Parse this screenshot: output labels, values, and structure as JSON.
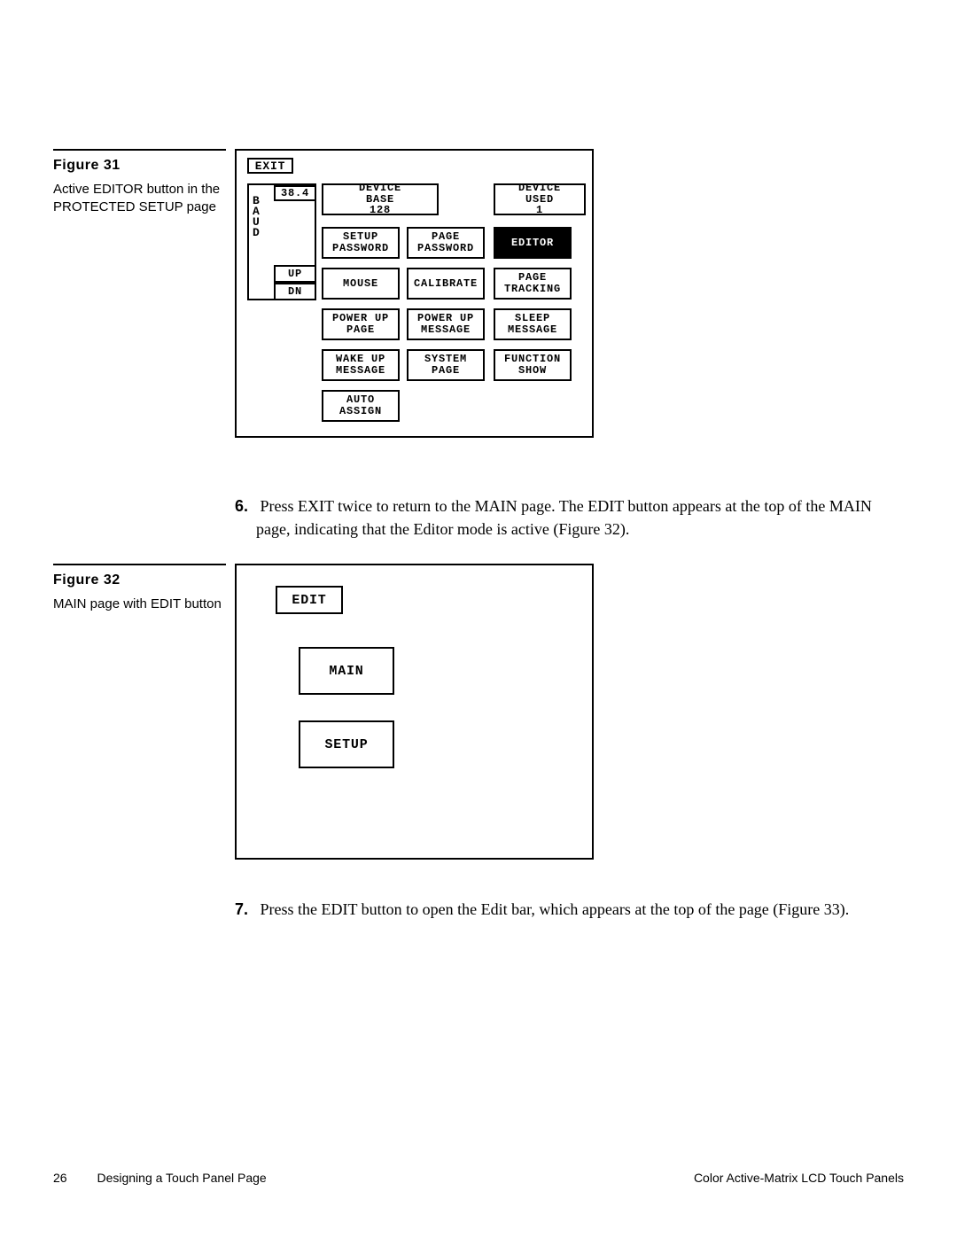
{
  "fig31": {
    "label": "Figure 31",
    "caption": "Active EDITOR button in the PROTECTED SETUP page",
    "exit": "EXIT",
    "baud": [
      "B",
      "A",
      "U",
      "D"
    ],
    "baud_value": "38.4",
    "up": "UP",
    "dn": "DN",
    "device_base_label": "DEVICE BASE",
    "device_base_val": "128",
    "device_used_label": "DEVICE USED",
    "device_used_val": "1",
    "setup_password": "SETUP PASSWORD",
    "page_password": "PAGE PASSWORD",
    "editor": "EDITOR",
    "mouse": "MOUSE",
    "calibrate": "CALIBRATE",
    "page_tracking": "PAGE TRACKING",
    "power_up_page": "POWER UP PAGE",
    "power_up_message": "POWER UP MESSAGE",
    "sleep_message": "SLEEP MESSAGE",
    "wake_up_message": "WAKE UP MESSAGE",
    "system_page": "SYSTEM PAGE",
    "function_show": "FUNCTION SHOW",
    "auto_assign": "AUTO ASSIGN"
  },
  "fig32": {
    "label": "Figure 32",
    "caption": "MAIN page with EDIT button",
    "edit": "EDIT",
    "main": "MAIN",
    "setup": "SETUP"
  },
  "steps": {
    "six_num": "6.",
    "six_text": "Press EXIT twice to return to the MAIN page. The EDIT button appears at the top of the MAIN page, indicating that the Editor mode is active (Figure 32).",
    "seven_num": "7.",
    "seven_text": "Press the EDIT button to open the Edit bar, which appears at the top of the page (Figure 33)."
  },
  "footer": {
    "page_number": "26",
    "left": "Designing a Touch Panel Page",
    "right": "Color Active-Matrix LCD Touch Panels"
  }
}
